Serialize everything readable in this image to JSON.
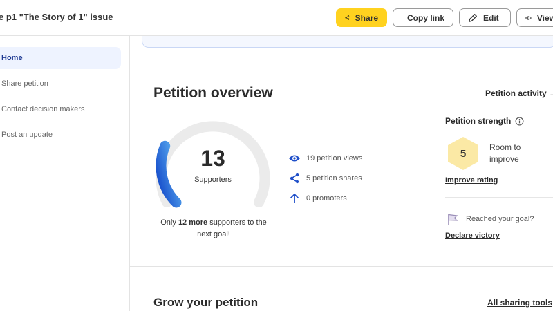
{
  "header": {
    "title": "e p1 \"The Story of 1\" issue",
    "share_label": "Share",
    "copy_label": "Copy link",
    "edit_label": "Edit",
    "view_label": "View"
  },
  "sidebar": {
    "items": [
      {
        "label": "Home",
        "active": true
      },
      {
        "label": "Share petition"
      },
      {
        "label": "Contact decision makers"
      },
      {
        "label": "Post an update"
      }
    ]
  },
  "overview": {
    "title": "Petition overview",
    "activity_link": "Petition activity →",
    "supporters_count": "13",
    "supporters_label": "Supporters",
    "goal_progress_fraction": 0.25,
    "goal_note_prefix": "Only ",
    "goal_note_bold": "12 more",
    "goal_note_suffix": " supporters to the next goal!",
    "stats": [
      {
        "icon": "eye-icon",
        "text": "19 petition views"
      },
      {
        "icon": "share-nodes-icon",
        "text": "5 petition shares"
      },
      {
        "icon": "arrow-up-icon",
        "text": "0 promoters"
      }
    ]
  },
  "strength": {
    "title": "Petition strength",
    "score": "5",
    "status": "Room to improve",
    "improve_link": "Improve rating",
    "reached_goal": "Reached your goal?",
    "declare_link": "Declare victory"
  },
  "grow": {
    "title": "Grow your petition",
    "all_tools_link": "All sharing tools"
  },
  "colors": {
    "accent_yellow": "#ffd21f",
    "gauge_blue_start": "#1247c9",
    "gauge_blue_end": "#5fb4f3",
    "gauge_track": "#ebebeb",
    "hexagon_fill": "#fbe9a5"
  }
}
